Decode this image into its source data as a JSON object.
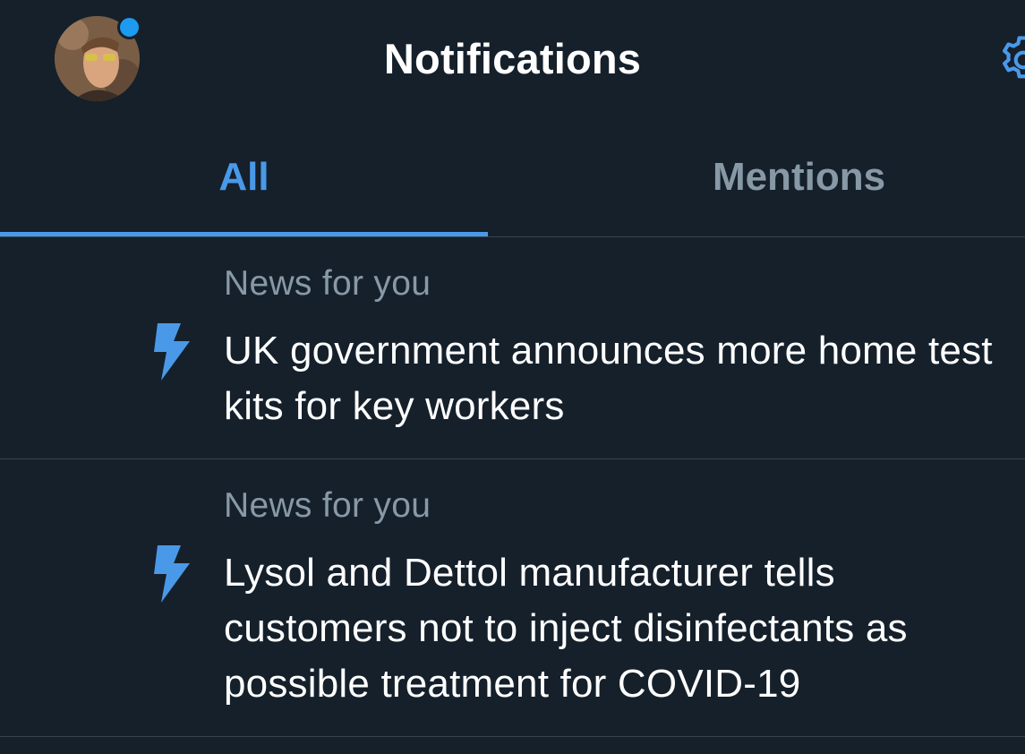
{
  "header": {
    "title": "Notifications",
    "avatar_icon": "user-avatar",
    "settings_icon": "gear-icon",
    "notification_dot_color": "#1d9bf0"
  },
  "tabs": [
    {
      "label": "All",
      "active": true
    },
    {
      "label": "Mentions",
      "active": false
    }
  ],
  "colors": {
    "background": "#15202b",
    "accent": "#4a99e9",
    "muted": "#8899a6",
    "divider": "#38444d"
  },
  "notifications": [
    {
      "label": "News for you",
      "icon": "lightning-bolt-icon",
      "text": "UK government announces more home test kits for key workers"
    },
    {
      "label": "News for you",
      "icon": "lightning-bolt-icon",
      "text": "Lysol and Dettol manufacturer tells customers not to inject disinfectants as possible treatment for COVID-19"
    }
  ]
}
